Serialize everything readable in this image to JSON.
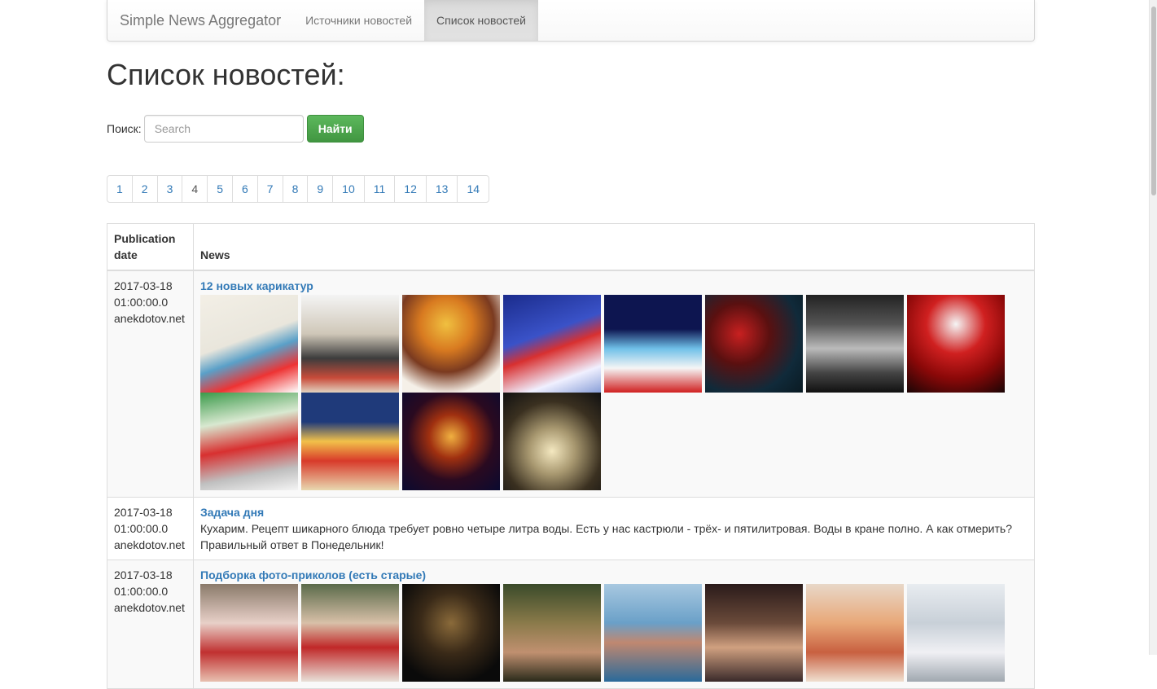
{
  "navbar": {
    "brand": "Simple News Aggregator",
    "items": [
      {
        "label": "Источники новостей",
        "active": false
      },
      {
        "label": "Список новостей",
        "active": true
      }
    ]
  },
  "page_title": "Список новостей:",
  "search": {
    "label": "Поиск:",
    "placeholder": "Search",
    "value": "",
    "button": "Найти"
  },
  "pagination": {
    "pages": [
      "1",
      "2",
      "3",
      "4",
      "5",
      "6",
      "7",
      "8",
      "9",
      "10",
      "11",
      "12",
      "13",
      "14"
    ],
    "active": "4"
  },
  "table": {
    "headers": {
      "date": "Publication date",
      "news": "News"
    },
    "rows": [
      {
        "date": "2017-03-18",
        "time": "01:00:00.0",
        "source": "anekdotov.net",
        "title": "12 новых карикатур",
        "text": "",
        "images": [
          "cartoon-santa-reindeer",
          "cartoon-child-potty",
          "cartoon-girl-sled",
          "cartoon-santa-motorcycle",
          "cartoon-santa-sled",
          "photo-santa-divers",
          "photo-frogs-school",
          "photo-santa-costume",
          "cartoon-santa-reading",
          "cartoon-santa-window",
          "photo-breaker-cover",
          "photo-child-lights"
        ]
      },
      {
        "date": "2017-03-18",
        "time": "01:00:00.0",
        "source": "anekdotov.net",
        "title": "Задача дня",
        "text": "Кухарим. Рецепт шикарного блюда требует ровно четыре литра воды. Есть у нас кастрюли - трёх- и пятилитровая. Воды в кране полно. А как отмерить? Правильный ответ в Понедельник!",
        "images": []
      },
      {
        "date": "2017-03-18",
        "time": "01:00:00.0",
        "source": "anekdotov.net",
        "title": "Подборка фото-приколов (есть старые)",
        "text": "",
        "images": [
          "photo-1",
          "photo-2",
          "photo-3",
          "photo-4",
          "photo-5",
          "photo-6",
          "photo-7",
          "photo-8"
        ]
      }
    ]
  },
  "colors": {
    "link": "#337ab7",
    "success": "#5cb85c",
    "border": "#dddddd",
    "stripe": "#f9f9f9"
  }
}
